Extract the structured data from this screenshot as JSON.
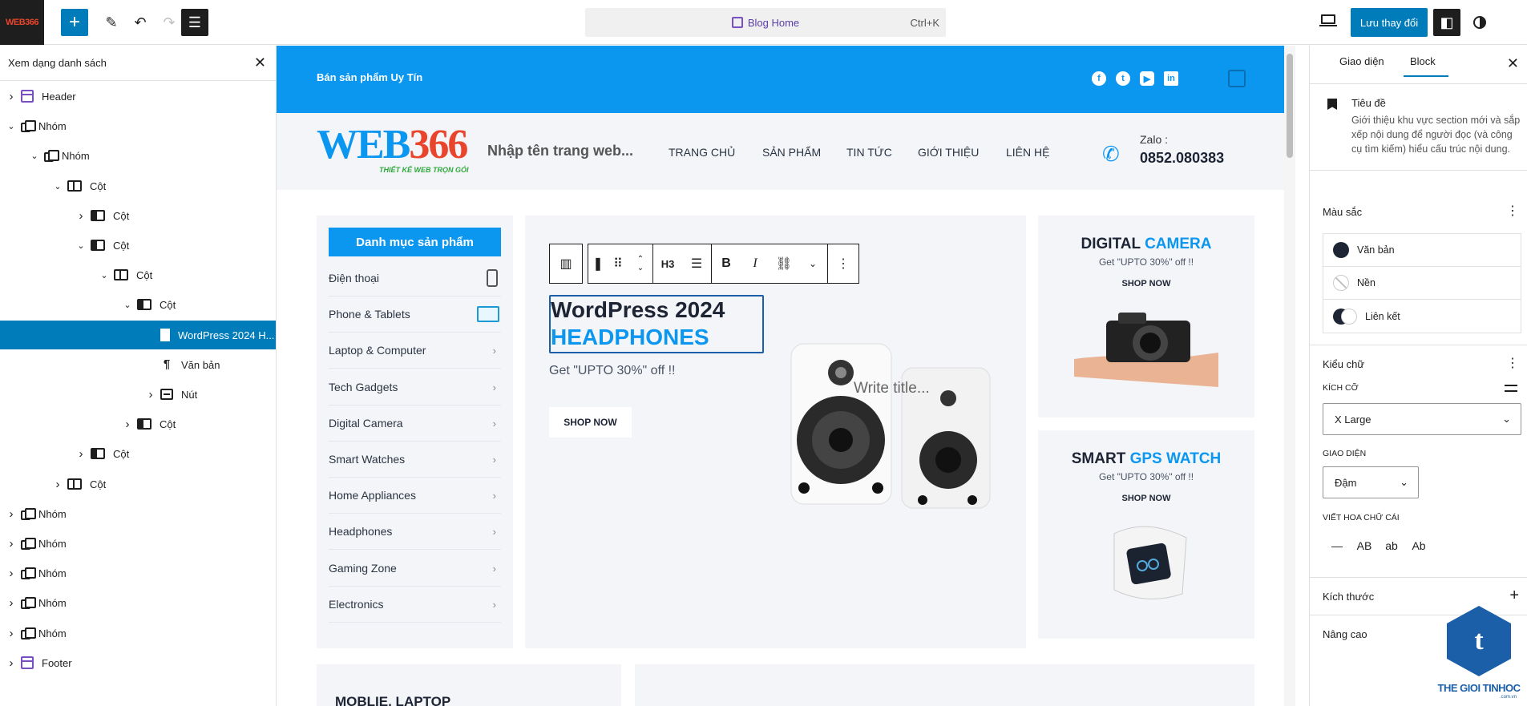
{
  "topbar": {
    "site_icon_text": "WEB366",
    "command_title": "Blog Home",
    "command_shortcut": "Ctrl+K",
    "save_label": "Lưu thay đổi",
    "icons": [
      "plus-icon",
      "pencil-icon",
      "undo-icon",
      "redo-icon",
      "list-view-icon",
      "desktop-icon",
      "settings-icon",
      "styles-icon"
    ]
  },
  "listview": {
    "title": "Xem dạng danh sách",
    "items": [
      {
        "label": "Header",
        "icon": "template-part-icon",
        "expanded": false
      },
      {
        "label": "Nhóm",
        "icon": "group-icon",
        "expanded": true
      },
      {
        "label": "Nhóm",
        "icon": "group-icon",
        "expanded": true
      },
      {
        "label": "Cột",
        "icon": "columns-icon",
        "expanded": true
      },
      {
        "label": "Cột",
        "icon": "column-icon",
        "expanded": false
      },
      {
        "label": "Cột",
        "icon": "column-icon",
        "expanded": true
      },
      {
        "label": "Cột",
        "icon": "columns-icon",
        "expanded": true
      },
      {
        "label": "Cột",
        "icon": "column-icon",
        "expanded": true
      },
      {
        "label": "WordPress 2024 H...",
        "icon": "heading-icon",
        "selected": true
      },
      {
        "label": "Văn bản",
        "icon": "paragraph-icon"
      },
      {
        "label": "Nút",
        "icon": "buttons-icon",
        "expanded": false
      },
      {
        "label": "Cột",
        "icon": "column-icon",
        "expanded": false
      },
      {
        "label": "Cột",
        "icon": "column-icon",
        "expanded": false
      },
      {
        "label": "Cột",
        "icon": "columns-icon",
        "expanded": false
      },
      {
        "label": "Nhóm",
        "icon": "group-icon",
        "expanded": false
      },
      {
        "label": "Nhóm",
        "icon": "group-icon",
        "expanded": false
      },
      {
        "label": "Nhóm",
        "icon": "group-icon",
        "expanded": false
      },
      {
        "label": "Nhóm",
        "icon": "group-icon",
        "expanded": false
      },
      {
        "label": "Nhóm",
        "icon": "group-icon",
        "expanded": false
      },
      {
        "label": "Footer",
        "icon": "template-part-icon",
        "expanded": false
      }
    ]
  },
  "site": {
    "trust_text": "Bán sản phẩm Uy Tín",
    "social": [
      "f",
      "t",
      "▶",
      "in"
    ],
    "logo_main_a": "WEB",
    "logo_main_b": "366",
    "logo_sub": "THIẾT KẾ WEB TRỌN GÓI",
    "site_title_placeholder": "Nhập tên trang web...",
    "nav": [
      "TRANG CHỦ",
      "SẢN PHẨM",
      "TIN TỨC",
      "GIỚI THIỆU",
      "LIÊN HỆ"
    ],
    "zalo_label": "Zalo :",
    "zalo_number": "0852.080383",
    "category_button": "Danh mục sản phẩm",
    "categories": [
      "Điện thoại",
      "Phone & Tablets",
      "Laptop & Computer",
      "Tech Gadgets",
      "Digital Camera",
      "Smart Watches",
      "Home Appliances",
      "Headphones",
      "Gaming Zone",
      "Electronics"
    ],
    "hero": {
      "heading_line1": "WordPress 2024",
      "heading_line2": "HEADPHONES",
      "subtitle": "Get \"UPTO 30%\" off !!",
      "button": "SHOP NOW",
      "write_title_placeholder": "Write title..."
    },
    "block_toolbar": {
      "heading_level": "H3"
    },
    "promo1": {
      "title_a": "DIGITAL",
      "title_b": "CAMERA",
      "subtitle": "Get \"UPTO 30%\" off !!",
      "button": "SHOP NOW"
    },
    "promo2": {
      "title_a": "SMART",
      "title_b": "GPS WATCH",
      "subtitle": "Get \"UPTO 30%\" off !!",
      "button": "SHOP NOW"
    },
    "bottom_left_title": "MOBLIE, LAPTOP"
  },
  "settings": {
    "tabs": [
      "Giao diện",
      "Block"
    ],
    "active_tab": "Block",
    "block_title": "Tiêu đề",
    "block_desc": "Giới thiệu khu vực section mới và sắp xếp nội dung để người đọc (và công cụ tìm kiếm) hiểu cấu trúc nội dung.",
    "color_panel": "Màu sắc",
    "colors": [
      "Văn bản",
      "Nền",
      "Liên kết"
    ],
    "typography_panel": "Kiểu chữ",
    "size_label": "KÍCH CỠ",
    "size_value": "X Large",
    "appearance_label": "GIAO DIỆN",
    "appearance_value": "Đậm",
    "letter_case_label": "VIẾT HOA CHỮ CÁI",
    "letter_case_options": [
      "—",
      "AB",
      "ab",
      "Ab"
    ],
    "dimensions_panel": "Kích thước",
    "advanced_panel": "Nâng cao",
    "accent_color": "#007cba"
  },
  "watermark": {
    "text": "THE GIOI TINHOC",
    "sub": ".com.vn",
    "letter": "t"
  }
}
